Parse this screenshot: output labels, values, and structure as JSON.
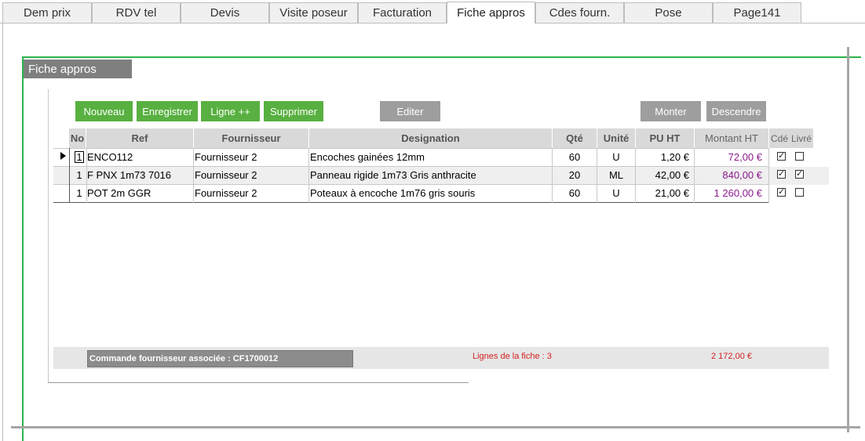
{
  "tabs": [
    {
      "label": "Dem prix"
    },
    {
      "label": "RDV tel"
    },
    {
      "label": "Devis"
    },
    {
      "label": "Visite poseur"
    },
    {
      "label": "Facturation"
    },
    {
      "label": "Fiche appros"
    },
    {
      "label": "Cdes fourn."
    },
    {
      "label": "Pose"
    },
    {
      "label": "Page141"
    }
  ],
  "active_tab": "Fiche appros",
  "section": {
    "title": "Fiche appros"
  },
  "toolbar": {
    "nouveau": "Nouveau",
    "enregistrer": "Enregistrer",
    "ligne_plus": "Ligne ++",
    "supprimer": "Supprimer",
    "editer": "Editer",
    "monter": "Monter",
    "descendre": "Descendre"
  },
  "grid": {
    "columns": [
      "No",
      "Ref",
      "Fournisseur",
      "Designation",
      "Qté",
      "Unité",
      "PU HT",
      "Montant HT",
      "Cdé",
      "Livré"
    ],
    "rows": [
      {
        "no": "1",
        "ref": "ENCO112",
        "fournisseur": "Fournisseur 2",
        "designation": "Encoches gainées 12mm",
        "qte": "60",
        "unite": "U",
        "pu_ht": "1,20 €",
        "montant_ht": "72,00 €",
        "cde": true,
        "livre": false
      },
      {
        "no": "1",
        "ref": "F PNX 1m73 7016",
        "fournisseur": "Fournisseur 2",
        "designation": "Panneau rigide 1m73 Gris anthracite",
        "qte": "20",
        "unite": "ML",
        "pu_ht": "42,00 €",
        "montant_ht": "840,00 €",
        "cde": true,
        "livre": true
      },
      {
        "no": "1",
        "ref": "POT 2m GGR",
        "fournisseur": "Fournisseur 2",
        "designation": "Poteaux à encoche 1m76 gris souris",
        "qte": "60",
        "unite": "U",
        "pu_ht": "21,00 €",
        "montant_ht": "1 260,00 €",
        "cde": true,
        "livre": false
      }
    ]
  },
  "footer": {
    "commande": "Commande fournisseur associée : CF1700012",
    "lines_count": "Lignes de la fiche : 3",
    "total": "2 172,00 €"
  },
  "colors": {
    "accent_green": "#58b040",
    "frame_green": "#2db34a",
    "button_grey": "#9e9e9e",
    "amount_purple": "#8b1a8b",
    "footer_red": "#d42020"
  }
}
